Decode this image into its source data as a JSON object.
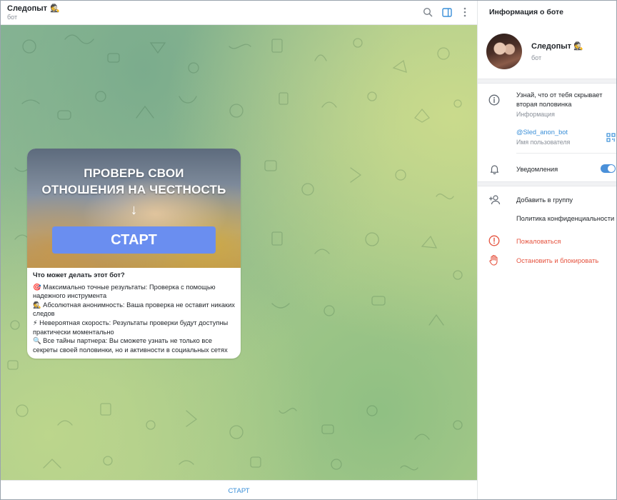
{
  "chat": {
    "title": "Следопыт",
    "title_emoji": "🕵",
    "status": "бот"
  },
  "message": {
    "image": {
      "line1": "ПРОВЕРЬ СВОИ",
      "line2": "ОТНОШЕНИЯ НА ЧЕСТНОСТЬ",
      "arrow": "↓",
      "button": "СТАРТ"
    },
    "heading": "Что может делать этот бот?",
    "items": [
      {
        "emoji": "🎯",
        "text": "Максимально точные результаты: Проверка с помощью надежного инструмента"
      },
      {
        "emoji": "🕵",
        "text": "Абсолютная анонимность: Ваша проверка не оставит никаких следов"
      },
      {
        "emoji": "⚡",
        "text": "Невероятная скорость: Результаты проверки будут доступны практически моментально"
      },
      {
        "emoji": "🔍",
        "text": "Все тайны партнера: Вы сможете узнать не только все секреты своей половинки, но и активности в социальных сетях"
      }
    ]
  },
  "bottom": {
    "start_label": "СТАРТ"
  },
  "panel": {
    "title": "Информация о боте",
    "bot_name": "Следопыт",
    "bot_emoji": "🕵",
    "bot_sub": "бот",
    "info_text": "Узнай, что от тебя скрывает вторая половинка",
    "info_label": "Информация",
    "username": "@Sled_anon_bot",
    "username_label": "Имя пользователя",
    "notifications": "Уведомления",
    "notifications_on": true,
    "add_to_group": "Добавить в группу",
    "privacy": "Политика конфиденциальности",
    "report": "Пожаловаться",
    "block": "Остановить и блокировать"
  },
  "colors": {
    "accent": "#3a8fd8",
    "danger": "#e5533f",
    "promo_button": "#6a8ef0"
  }
}
